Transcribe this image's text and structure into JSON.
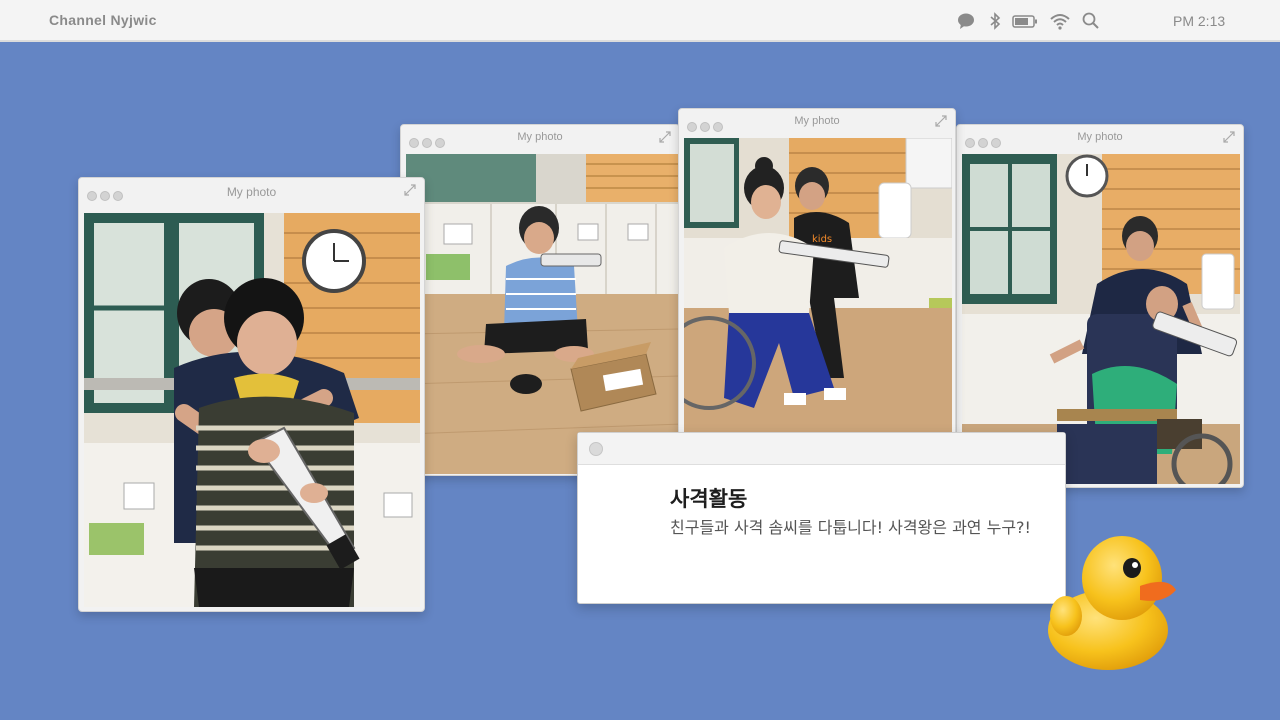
{
  "menubar": {
    "brand": "Channel Nyjwic",
    "clock": "PM  2:13",
    "icons": [
      "chat-icon",
      "bluetooth-icon",
      "battery-icon",
      "wifi-icon",
      "search-icon"
    ]
  },
  "windows": [
    {
      "title": "My photo",
      "photo": "boy in striped shirt aiming toy gun, helped from behind by adult"
    },
    {
      "title": "My photo",
      "photo": "boy sitting on floor holding toy gun next to box"
    },
    {
      "title": "My photo",
      "photo": "girl in wheelchair aiming toy gun, helped by adult"
    },
    {
      "title": "My photo",
      "photo": "boy in wheelchair aiming toy gun, helped by adult"
    }
  ],
  "card": {
    "title": "사격활동",
    "body": "친구들과 사격 솜씨를 다툽니다! 사격왕은 과연 누구?!"
  },
  "colors": {
    "background": "#6485c4",
    "menubar": "#f4f4f4",
    "window_chrome": "#f2f2f2",
    "duck_body": "#f7c21c",
    "duck_beak": "#f06c1e"
  },
  "decor": {
    "mascot": "rubber-duck-icon"
  }
}
